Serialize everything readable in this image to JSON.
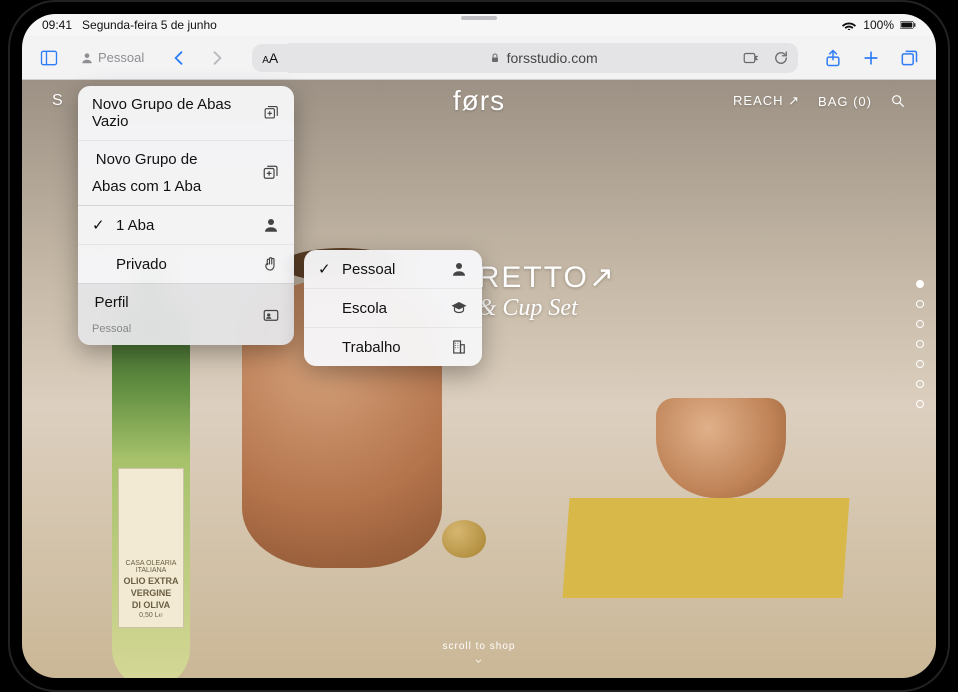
{
  "status": {
    "time": "09:41",
    "date": "Segunda-feira 5 de junho",
    "battery": "100%"
  },
  "toolbar": {
    "profile_label": "Pessoal",
    "aa_label": "AA",
    "domain": "forsstudio.com"
  },
  "tab_menu": {
    "new_empty_group": "Novo Grupo de Abas Vazio",
    "new_group_one_tab_line1": "Novo Grupo de",
    "new_group_one_tab_line2": "Abas com 1 Aba",
    "one_tab": "1 Aba",
    "private": "Privado",
    "profile_label": "Perfil",
    "profile_value": "Pessoal"
  },
  "profile_menu": {
    "items": [
      {
        "label": "Pessoal",
        "icon": "person",
        "checked": true
      },
      {
        "label": "Escola",
        "icon": "graduation",
        "checked": false
      },
      {
        "label": "Trabalho",
        "icon": "building",
        "checked": false
      }
    ]
  },
  "site": {
    "shop_link": "S",
    "logo": "førs",
    "reach": "REACH ↗",
    "bag": "BAG (0)",
    "hero_line1": "RETTO↗",
    "hero_line2": "& Cup Set",
    "scroll_hint": "scroll to shop",
    "bottle_label_brand": "CASA OLEARIA ITALIANA",
    "bottle_label_line1": "OLIO EXTRA",
    "bottle_label_line2": "VERGINE",
    "bottle_label_line3": "DI OLIVA",
    "bottle_label_size": "0,50 L℮"
  }
}
